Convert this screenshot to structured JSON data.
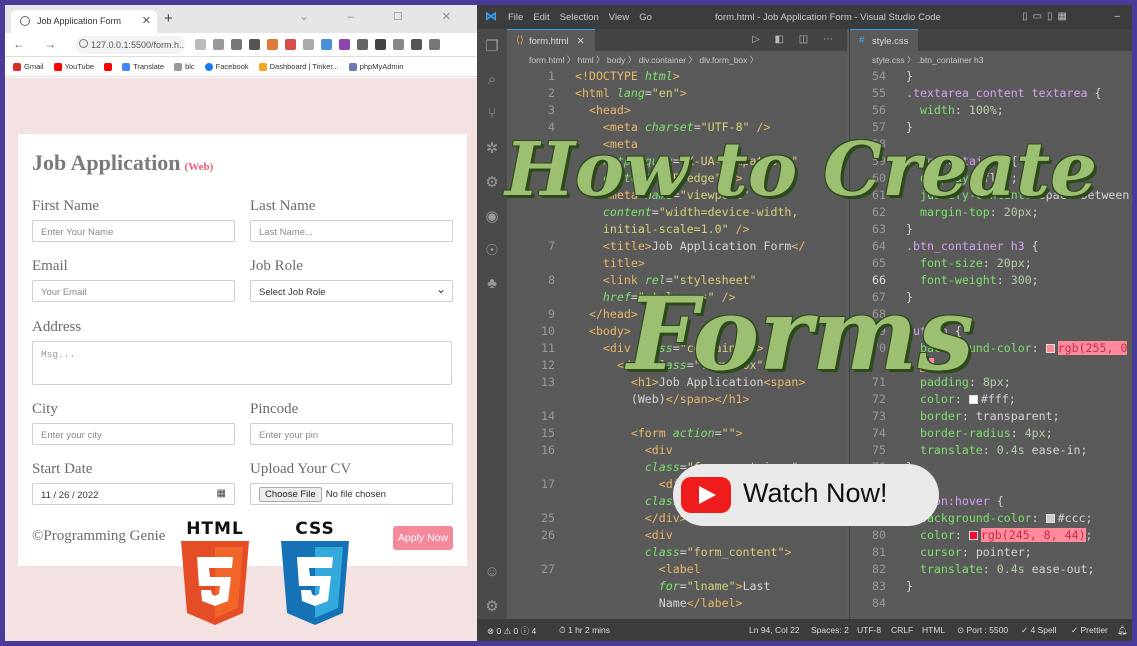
{
  "browser": {
    "tab_title": "Job Application Form",
    "url": "127.0.0.1:5500/form.h...",
    "bookmarks": [
      "Gmail",
      "YouTube",
      "",
      "Translate",
      "blc",
      "Facebook",
      "Dashboard | Tinker...",
      "phpMyAdmin"
    ]
  },
  "form": {
    "title": "Job Application",
    "title_tag": "(Web)",
    "first_name": {
      "label": "First Name",
      "placeholder": "Enter Your Name"
    },
    "last_name": {
      "label": "Last Name",
      "placeholder": "Last Name..."
    },
    "email": {
      "label": "Email",
      "placeholder": "Your Email"
    },
    "job_role": {
      "label": "Job Role",
      "selected": "Select Job Role"
    },
    "address": {
      "label": "Address",
      "placeholder": "Msg..."
    },
    "city": {
      "label": "City",
      "placeholder": "Enter your city"
    },
    "pincode": {
      "label": "Pincode",
      "placeholder": "Enter your pin"
    },
    "start_date": {
      "label": "Start Date",
      "value": "11 / 26 / 2022"
    },
    "cv": {
      "label": "Upload Your CV",
      "button": "Choose File",
      "status": "No file chosen"
    },
    "copyright": "©Programming Genie",
    "apply": "Apply Now"
  },
  "badges": {
    "html": "HTML",
    "css": "CSS"
  },
  "vscode": {
    "menu": [
      "File",
      "Edit",
      "Selection",
      "View",
      "Go"
    ],
    "window_title": "form.html - Job Application Form - Visual Studio Code",
    "tab1": "form.html",
    "tab2": "style.css",
    "crumb1": "form.html  〉 html 〉 body 〉 div.container 〉 div.form_box 〉",
    "crumb2": "style.css 〉 .btn_container h3",
    "status": {
      "problems": "⊗ 0 ⚠ 0  ⓘ 4",
      "time": "⏱ 1 hr 2 mins",
      "position": "Ln 94, Col 22",
      "spaces": "Spaces: 2",
      "encoding": "UTF-8",
      "eol": "CRLF",
      "lang": "HTML",
      "port": "⊙ Port : 5500",
      "spell": "✓ 4 Spell",
      "prettier": "✓ Prettier"
    }
  },
  "overlay": {
    "headline": "How to Create",
    "subline": "Forms",
    "watch": "Watch Now!"
  }
}
